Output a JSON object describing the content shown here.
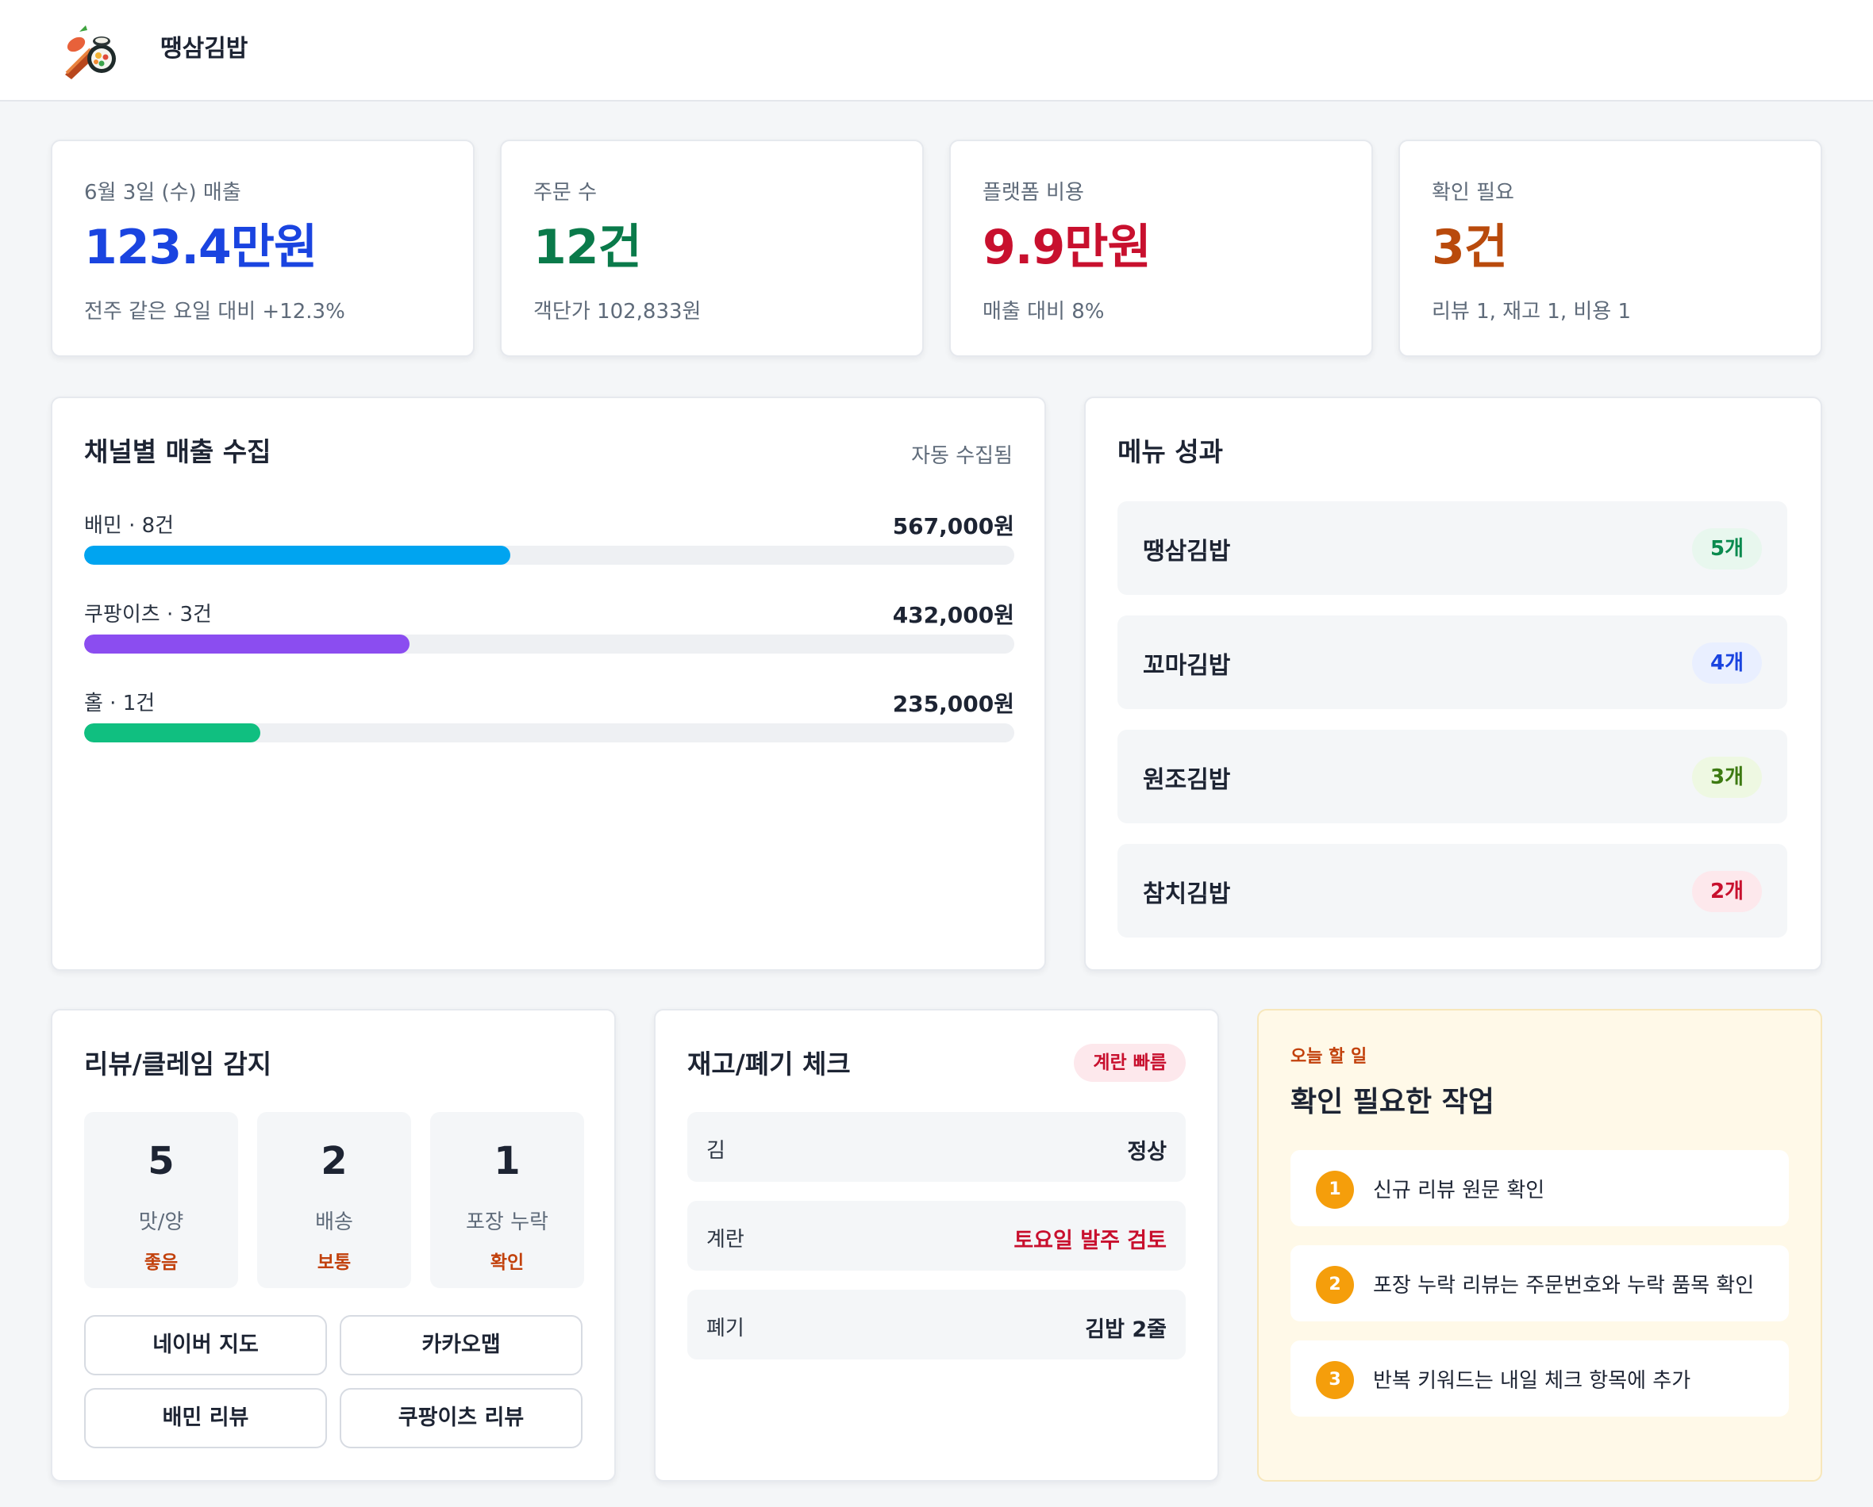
{
  "app": {
    "title": "땡삼김밥",
    "logo_icon": "kimbap-logo-icon"
  },
  "kpis": [
    {
      "label": "6월 3일 (수) 매출",
      "value": "123.4만원",
      "sub": "전주 같은 요일 대비 +12.3%",
      "color": "#1a44e0"
    },
    {
      "label": "주문 수",
      "value": "12건",
      "sub": "객단가 102,833원",
      "color": "#0a7a4a"
    },
    {
      "label": "플랫폼 비용",
      "value": "9.9만원",
      "sub": "매출 대비 8%",
      "color": "#c8102e"
    },
    {
      "label": "확인 필요",
      "value": "3건",
      "sub": "리뷰 1, 재고 1, 비용 1",
      "color": "#b94a0c"
    }
  ],
  "channels": {
    "title": "채널별 매출 수집",
    "status": "자동 수집됨",
    "items": [
      {
        "label": "배민 · 8건",
        "amount": "567,000원",
        "fill": 0.46,
        "color": "#00a4f0"
      },
      {
        "label": "쿠팡이츠 · 3건",
        "amount": "432,000원",
        "fill": 0.35,
        "color": "#8b4df0"
      },
      {
        "label": "홀 · 1건",
        "amount": "235,000원",
        "fill": 0.19,
        "color": "#10bf80"
      }
    ]
  },
  "menu": {
    "title": "메뉴 성과",
    "items": [
      {
        "name": "땡삼김밥",
        "count": "5개",
        "color": "#0a8a4e",
        "bg": "#e8f7ee"
      },
      {
        "name": "꼬마김밥",
        "count": "4개",
        "color": "#1a44e0",
        "bg": "#e9efff"
      },
      {
        "name": "원조김밥",
        "count": "3개",
        "color": "#3d7a12",
        "bg": "#eef8e2"
      },
      {
        "name": "참치김밥",
        "count": "2개",
        "color": "#c8102e",
        "bg": "#fde8ec"
      }
    ]
  },
  "reviews": {
    "title": "리뷰/클레임 감지",
    "stats": [
      {
        "num": "5",
        "name": "맛/양",
        "state": "좋음"
      },
      {
        "num": "2",
        "name": "배송",
        "state": "보통"
      },
      {
        "num": "1",
        "name": "포장 누락",
        "state": "확인"
      }
    ],
    "buttons": [
      "네이버 지도",
      "카카오맵",
      "배민 리뷰",
      "쿠팡이츠 리뷰"
    ]
  },
  "stock": {
    "title": "재고/폐기 체크",
    "badge": "계란 빠름",
    "rows": [
      {
        "name": "김",
        "state": "정상",
        "color": "#1d2433"
      },
      {
        "name": "계란",
        "state": "토요일 발주 검토",
        "color": "#c8102e"
      },
      {
        "name": "폐기",
        "state": "김밥 2줄",
        "color": "#1d2433"
      }
    ]
  },
  "todo": {
    "tag": "오늘 할 일",
    "title": "확인 필요한 작업",
    "tasks": [
      {
        "num": "1",
        "text": "신규 리뷰 원문 확인"
      },
      {
        "num": "2",
        "text": "포장 누락 리뷰는 주문번호와 누락 품목 확인"
      },
      {
        "num": "3",
        "text": "반복 키워드는 내일 체크 항목에 추가"
      }
    ]
  }
}
